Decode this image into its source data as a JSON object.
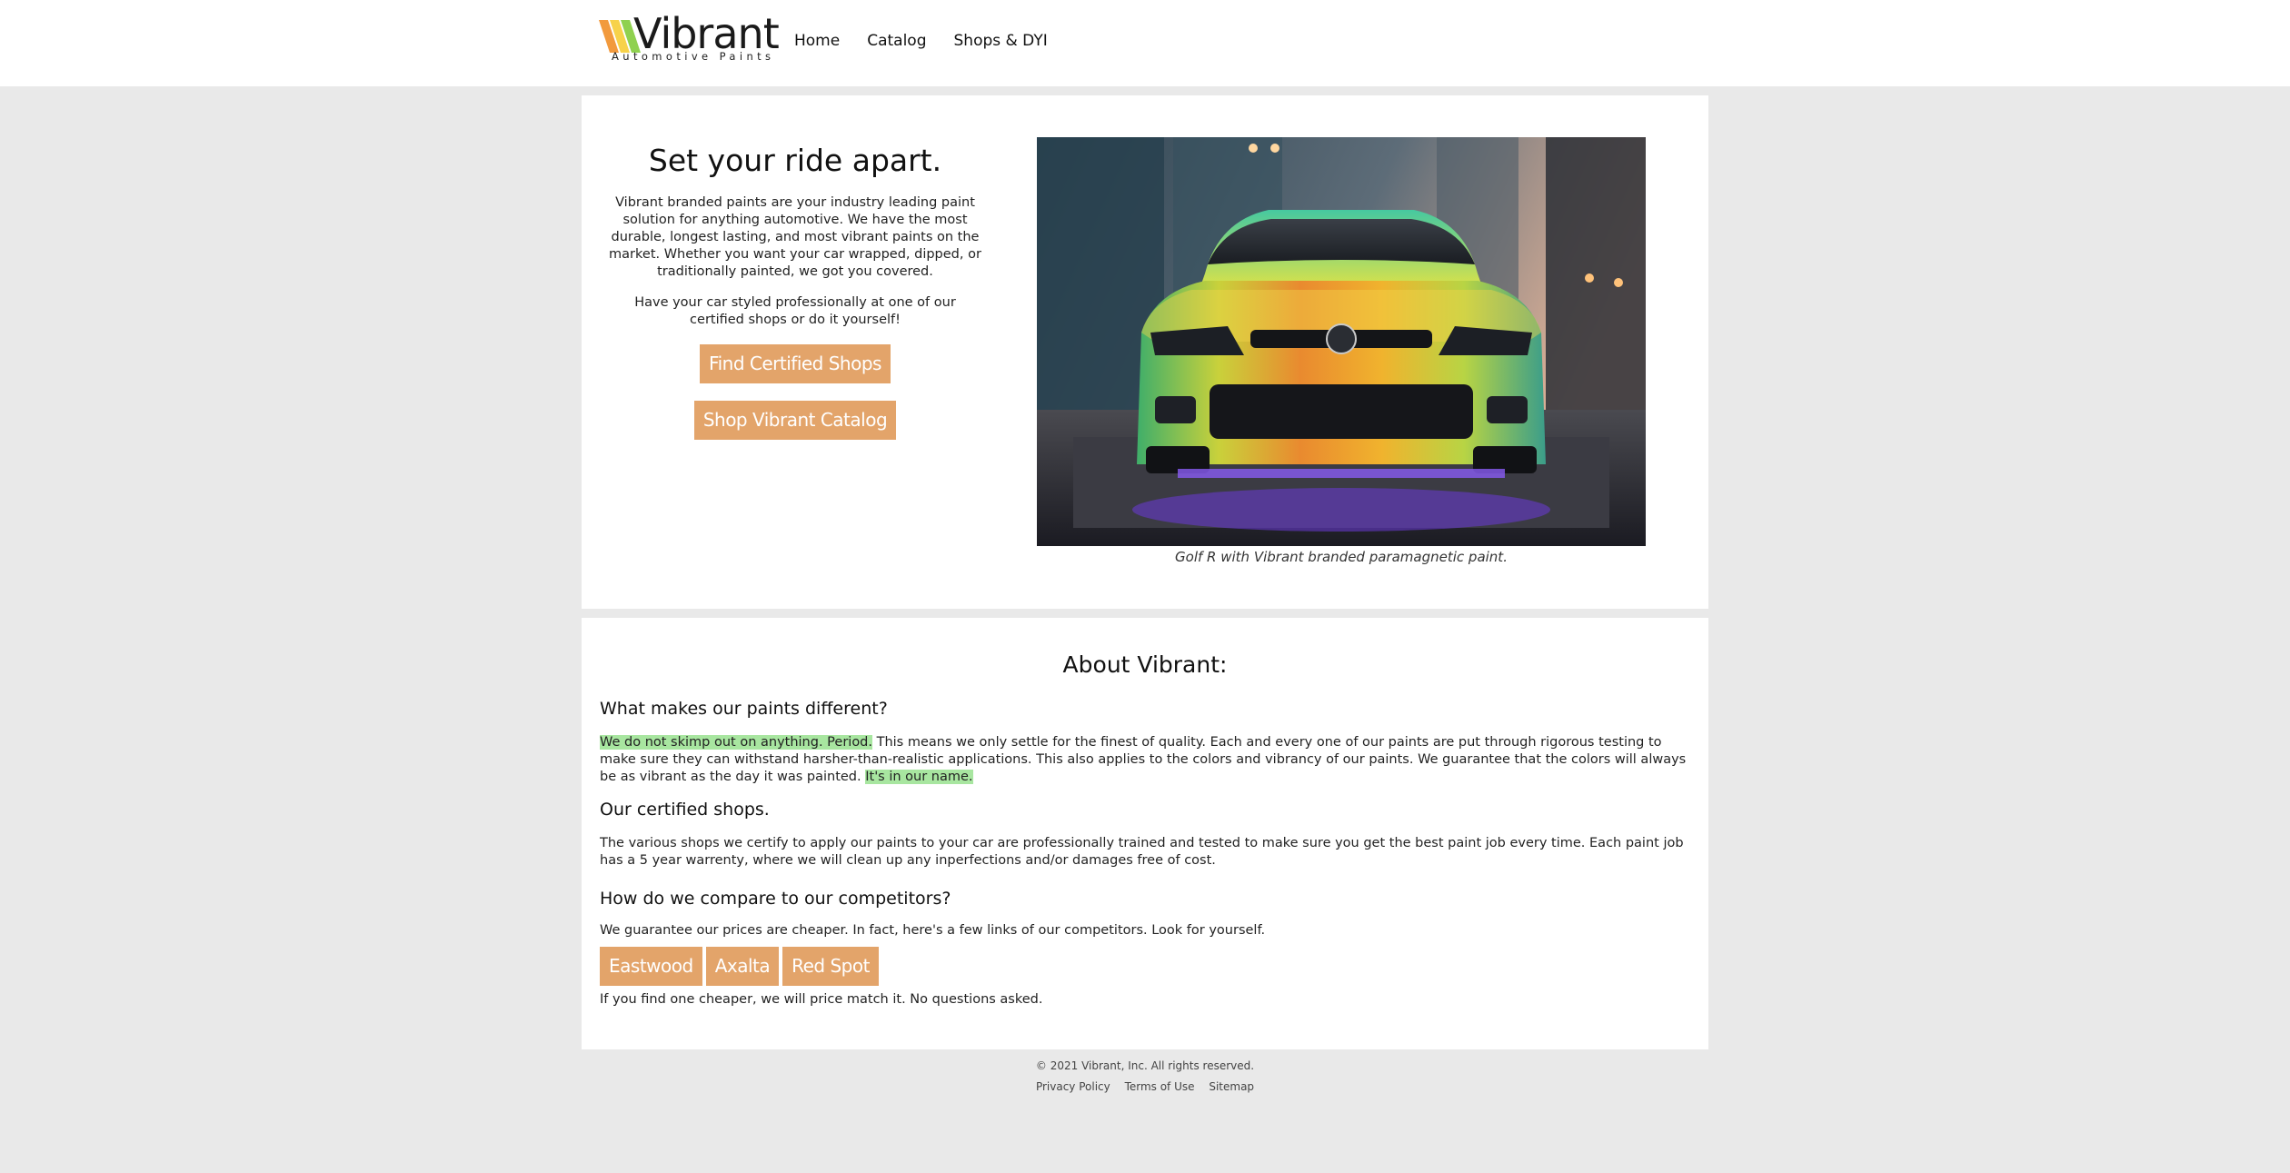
{
  "brand": {
    "name": "Vibrant",
    "tagline": "Automotive Paints",
    "colors": {
      "accent": "#e3a46a",
      "highlight": "#a8e6a0",
      "stripe1": "#f29a3d",
      "stripe2": "#f7d24a",
      "stripe3": "#8fd14f"
    }
  },
  "nav": {
    "items": [
      "Home",
      "Catalog",
      "Shops & DYI"
    ]
  },
  "hero": {
    "title": "Set your ride apart.",
    "paragraph1": "Vibrant branded paints are your industry leading paint solution for anything automotive. We have the most durable, longest lasting, and most vibrant paints on the market. Whether you want your car wrapped, dipped, or traditionally painted, we got you covered.",
    "paragraph2": "Have your car styled professionally at one of our certified shops or do it yourself!",
    "button_shops": "Find Certified Shops",
    "button_catalog": "Shop Vibrant Catalog",
    "image_caption": "Golf R with Vibrant branded paramagnetic paint."
  },
  "about": {
    "title": "About Vibrant:",
    "section1": {
      "heading": "What makes our paints different?",
      "highlight_start": "We do not skimp out on anything. Period.",
      "body": " This means we only settle for the finest of quality. Each and every one of our paints are put through rigorous testing to make sure they can withstand harsher-than-realistic applications. This also applies to the colors and vibrancy of our paints. We guarantee that the colors will always be as vibrant as the day it was painted. ",
      "highlight_end": "It's in our name."
    },
    "section2": {
      "heading": "Our certified shops.",
      "body": "The various shops we certify to apply our paints to your car are professionally trained and tested to make sure you get the best paint job every time. Each paint job has a 5 year warrenty, where we will clean up any inperfections and/or damages free of cost."
    },
    "section3": {
      "heading": "How do we compare to our competitors?",
      "body": "We guarantee our prices are cheaper. In fact, here's a few links of our competitors. Look for yourself.",
      "competitors": [
        "Eastwood",
        "Axalta",
        "Red Spot"
      ],
      "footnote": "If you find one cheaper, we will price match it. No questions asked."
    }
  },
  "footer": {
    "copyright": "© 2021 Vibrant, Inc. All rights reserved.",
    "links": [
      "Privacy Policy",
      "Terms of Use",
      "Sitemap"
    ]
  }
}
